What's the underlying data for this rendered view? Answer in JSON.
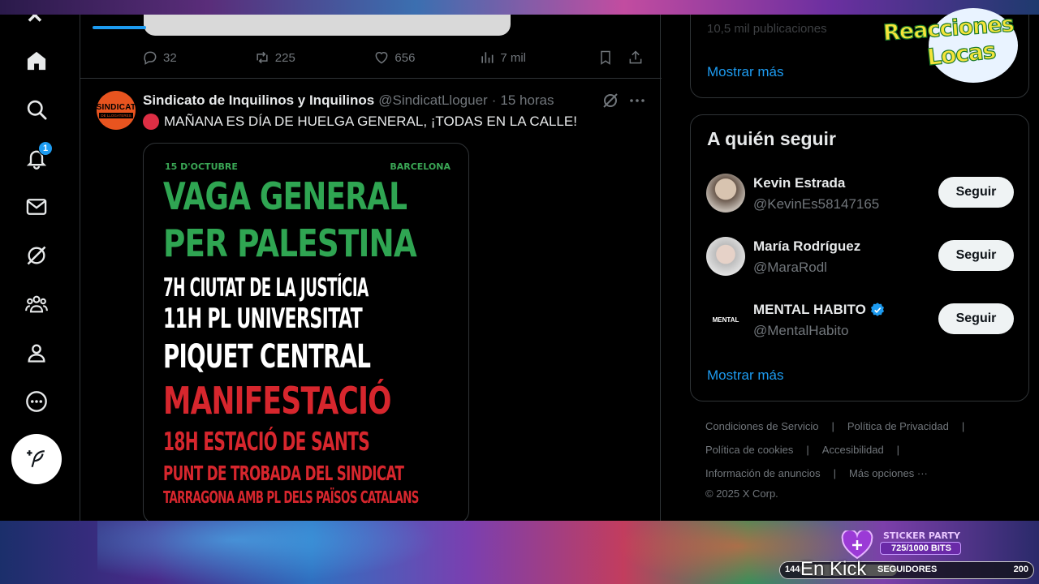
{
  "prev_tweet": {
    "replies": "32",
    "reposts": "225",
    "likes": "656",
    "views": "7 mil"
  },
  "tweet": {
    "name": "Sindicato de Inquilinos y Inquilinos",
    "handle": "@SindicatLloguer",
    "dot": "·",
    "time": "15 horas",
    "text": "MAÑANA ES DÍA DE HUELGA GENERAL, ¡TODAS EN LA CALLE!",
    "avatar_line1": "SINDICAT",
    "avatar_line2": "DE LLOGATERES",
    "poster": {
      "date": "15 D'OCTUBRE",
      "city": "BARCELONA",
      "lines": [
        "VAGA GENERAL",
        "PER PALESTINA",
        "7H CIUTAT DE LA JUSTÍCIA",
        "11H PL UNIVERSITAT",
        "PIQUET CENTRAL",
        "MANIFESTACIÓ",
        "18H ESTACIÓ DE SANTS",
        "PUNT DE TROBADA DEL SINDICAT",
        "TARRAGONA AMB PL DELS PAÏSOS CATALANS"
      ],
      "colors": {
        "green": "#2fa552",
        "white": "#ffffff",
        "red": "#d6262d"
      }
    }
  },
  "right": {
    "top_card_faded": "10,5 mil publicaciones",
    "top_card_more": "Mostrar más",
    "who_to_follow": {
      "title": "A quién seguir",
      "users": [
        {
          "name": "Kevin Estrada",
          "handle": "@KevinEs58147165",
          "button": "Seguir"
        },
        {
          "name": "María Rodríguez",
          "handle": "@MaraRodl",
          "button": "Seguir"
        },
        {
          "name": "MENTAL HABITO",
          "handle": "@MentalHabito",
          "button": "Seguir",
          "avatar_text": "MENTAL"
        }
      ],
      "more": "Mostrar más"
    },
    "footer": {
      "terms": "Condiciones de Servicio",
      "privacy": "Política de Privacidad",
      "cookies": "Política de cookies",
      "accessibility": "Accesibilidad",
      "ads": "Información de anuncios",
      "more": "Más opciones ···",
      "copyright": "© 2025 X Corp."
    }
  },
  "nav": {
    "notifications_badge": "1"
  },
  "overlay": {
    "logo_line1": "Reacciones",
    "logo_line2": "Locas",
    "sticker_title": "STICKER PARTY",
    "sticker_bits": "725/1000 BITS",
    "kick_count": "144",
    "kick_label": "SEGUIDORES",
    "kick_goal": "200",
    "kick_text": "En Kick",
    "accent": "#1d9bf0"
  }
}
